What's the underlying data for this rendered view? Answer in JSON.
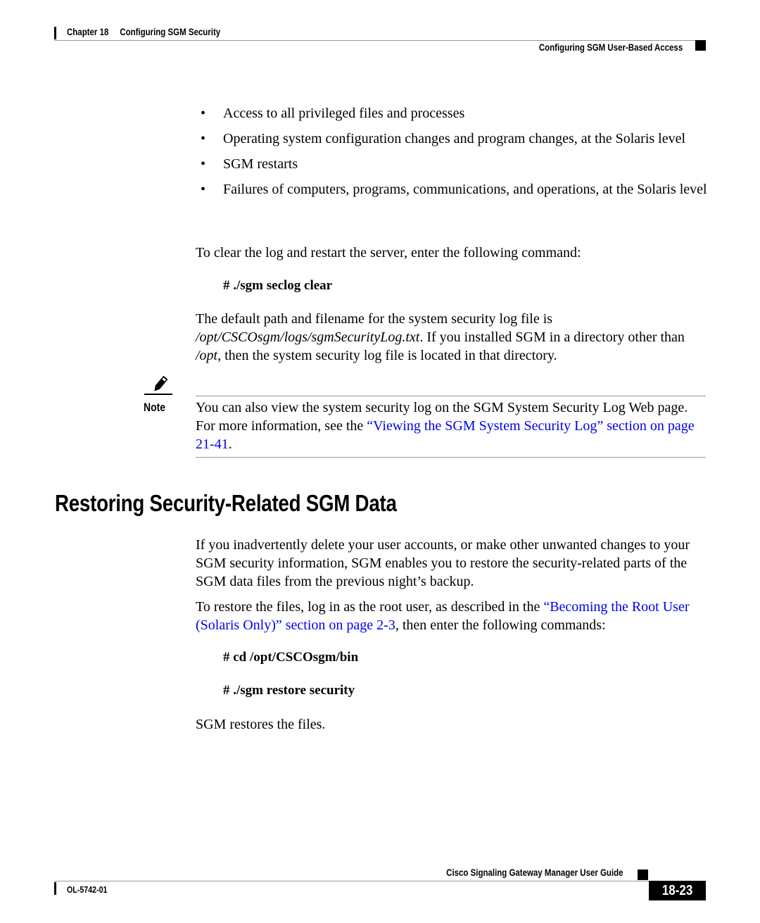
{
  "header": {
    "chapter_label": "Chapter 18",
    "chapter_title": "Configuring SGM Security",
    "section_title": "Configuring SGM User-Based Access"
  },
  "bullets": [
    "Access to all privileged files and processes",
    "Operating system configuration changes and program changes, at the Solaris level",
    "SGM restarts",
    "Failures of computers, programs, communications, and operations, at the Solaris level"
  ],
  "bullet_glyph": "•",
  "clear_log": {
    "intro": "To clear the log and restart the server, enter the following command:",
    "command": "# ./sgm seclog clear"
  },
  "default_path": {
    "text_1": "The default path and filename for the system security log file is ",
    "path": "/opt/CSCOsgm/logs/sgmSecurityLog.txt",
    "text_2": ". If you installed SGM in a directory other than ",
    "opt": "/opt",
    "text_3": ", then the system security log file is located in that directory."
  },
  "note": {
    "icon": "pencil-note-icon",
    "label": "Note",
    "text_1": "You can also view the system security log on the SGM System Security Log Web page. For more information, see the ",
    "link_text": "“Viewing the SGM System Security Log” section on page 21-41",
    "text_2": "."
  },
  "section": {
    "heading": "Restoring Security-Related SGM Data",
    "para_1": "If you inadvertently delete your user accounts, or make other unwanted changes to your SGM security information, SGM enables you to restore the security-related parts of the SGM data files from the previous night’s backup.",
    "para_2_text_1": "To restore the files, log in as the root user, as described in the ",
    "para_2_link": "“Becoming the Root User (Solaris Only)” section on page 2-3",
    "para_2_text_2": ", then enter the following commands:",
    "commands": [
      "# cd /opt/CSCOsgm/bin",
      "# ./sgm restore security"
    ],
    "result": "SGM restores the files."
  },
  "footer": {
    "guide_title": "Cisco Signaling Gateway Manager User Guide",
    "doc_number": "OL-5742-01",
    "page_number": "18-23"
  },
  "colors": {
    "link": "#0000ee",
    "rule": "#999999",
    "text": "#000000"
  }
}
